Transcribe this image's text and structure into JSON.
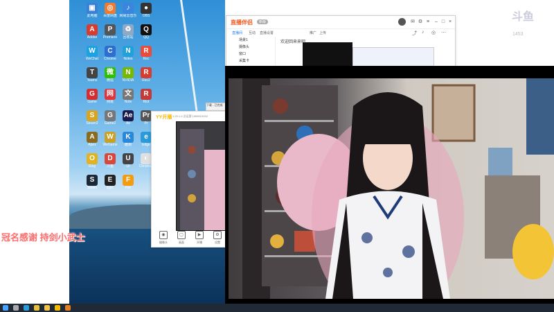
{
  "desktop": {
    "icons": [
      {
        "label": "此电脑",
        "color": "#3b7fd6",
        "glyph": "▣"
      },
      {
        "label": "百度网盘",
        "color": "#ef7b30",
        "glyph": "◎"
      },
      {
        "label": "网易云音乐",
        "color": "#3a85dd",
        "glyph": "♪"
      },
      {
        "label": "OBS",
        "color": "#333333",
        "glyph": "●"
      },
      {
        "label": "Adobe",
        "color": "#d93c2f",
        "glyph": "A"
      },
      {
        "label": "Premiere",
        "color": "#555555",
        "glyph": "P"
      },
      {
        "label": "回收站",
        "color": "#8fa9c5",
        "glyph": "♻"
      },
      {
        "label": "QQ",
        "color": "#111111",
        "glyph": "Q"
      },
      {
        "label": "WeChat",
        "color": "#1aa2e3",
        "glyph": "W"
      },
      {
        "label": "Chrome",
        "color": "#2c6fd0",
        "glyph": "C"
      },
      {
        "label": "Notes",
        "color": "#22a0d8",
        "glyph": "N"
      },
      {
        "label": "Rec",
        "color": "#e74c3c",
        "glyph": "R"
      },
      {
        "label": "Teams",
        "color": "#444444",
        "glyph": "T"
      },
      {
        "label": "微信",
        "color": "#2dc100",
        "glyph": "微"
      },
      {
        "label": "NVIDIA",
        "color": "#76b900",
        "glyph": "N"
      },
      {
        "label": "Rec2",
        "color": "#d43d2f",
        "glyph": "R"
      },
      {
        "label": "Game",
        "color": "#d42e2e",
        "glyph": "G"
      },
      {
        "label": "网易",
        "color": "#e0353a",
        "glyph": "网"
      },
      {
        "label": "Note",
        "color": "#777777",
        "glyph": "文"
      },
      {
        "label": "Riot",
        "color": "#c33a3a",
        "glyph": "R"
      },
      {
        "label": "Steam2",
        "color": "#d9a520",
        "glyph": "S"
      },
      {
        "label": "Game2",
        "color": "#777777",
        "glyph": "G"
      },
      {
        "label": "Ae",
        "color": "#1b1a4d",
        "glyph": "Ae"
      },
      {
        "label": "Pr",
        "color": "#555555",
        "glyph": "Pr"
      },
      {
        "label": "Apex",
        "color": "#8a6b20",
        "glyph": "A"
      },
      {
        "label": "WeGame",
        "color": "#c9a12a",
        "glyph": "W"
      },
      {
        "label": "酷狗",
        "color": "#2a88d8",
        "glyph": "K"
      },
      {
        "label": "Edge",
        "color": "#2a9ad8",
        "glyph": "e"
      },
      {
        "label": "Ring",
        "color": "#e3b21f",
        "glyph": "O"
      },
      {
        "label": "斗鱼",
        "color": "#d9463a",
        "glyph": "D"
      },
      {
        "label": "UI",
        "color": "#444444",
        "glyph": "U"
      },
      {
        "label": "Chrome2",
        "color": "#e0e0e0",
        "glyph": "◐"
      },
      {
        "label": "Steam",
        "color": "#1b2838",
        "glyph": "S"
      },
      {
        "label": "Epic",
        "color": "#222222",
        "glyph": "E"
      },
      {
        "label": "Fire",
        "color": "#f39c12",
        "glyph": "F"
      }
    ]
  },
  "watermark": {
    "text": "斗鱼",
    "sub": "1453"
  },
  "stream_helper": {
    "logo": "直播伴侣",
    "badge": "新版",
    "tabs": [
      "直播间",
      "互动",
      "直播设置",
      "推广",
      "上传"
    ],
    "left_items": [
      "场景1",
      "摄像头",
      "窗口",
      "采集卡"
    ],
    "mid_text": "欢迎回来来吧"
  },
  "yy": {
    "logo": "YY开播",
    "version": "1.29.1.0  总运营 1568022452",
    "buttons": [
      {
        "label": "摄像头",
        "glyph": "◉"
      },
      {
        "label": "画面",
        "glyph": "▢"
      },
      {
        "label": "开播",
        "glyph": "▶"
      },
      {
        "label": "设置",
        "glyph": "⚙"
      }
    ]
  },
  "mini_window": {
    "text": "下载 - 已完成"
  },
  "overlay": {
    "text": "冠名感谢 持剑小武士"
  },
  "taskbar": {
    "icons": [
      "windows",
      "search",
      "edge",
      "chrome",
      "folder",
      "yy",
      "store"
    ]
  }
}
